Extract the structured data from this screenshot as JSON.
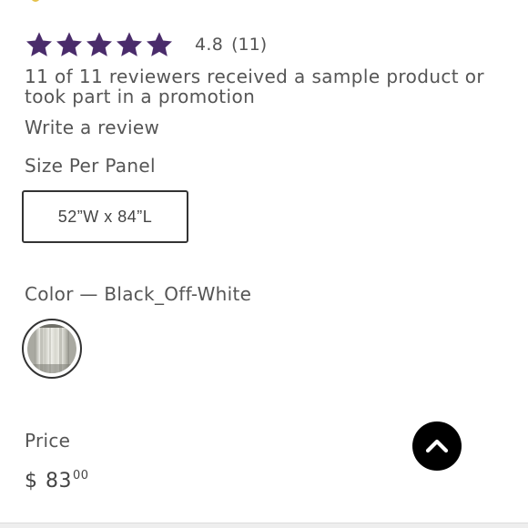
{
  "rating": {
    "stars_filled": 5,
    "stars_total": 5,
    "value": "4.8",
    "count": "(11)",
    "star_color": "#4a2c6b"
  },
  "disclaimer": "11 of 11 reviewers received a sample product or took part in a promotion",
  "write_review_label": "Write a review",
  "size": {
    "label": "Size Per Panel",
    "selected_option": "52”W x 84”L"
  },
  "color": {
    "label": "Color — Black_Off-White"
  },
  "price": {
    "label": "Price",
    "currency": "$",
    "dollars": "83",
    "cents": "00"
  },
  "scroll_top": {
    "icon": "chevron-up-icon",
    "background": "#000000"
  }
}
